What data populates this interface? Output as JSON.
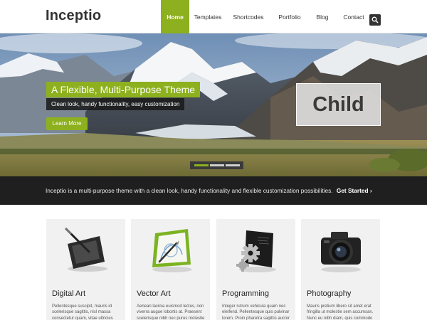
{
  "header": {
    "logo": "Inceptio",
    "nav": [
      "Home",
      "Templates",
      "Shortcodes",
      "Portfolio",
      "Blog",
      "Contact"
    ],
    "search_icon": "search-icon"
  },
  "hero": {
    "title": "A Flexible, Multi-Purpose Theme",
    "subtitle": "Clean look, handy functionality, easy customization",
    "button": "Learn More",
    "badge": "Child",
    "slides_total": 3,
    "active_slide": 1
  },
  "tagline": {
    "text": "Inceptio is a multi-purpose theme with a clean look, handy functionality and flexible customization possibilities.",
    "cta": "Get Started ›"
  },
  "features": [
    {
      "title": "Digital Art",
      "icon": "drawing-tablet-icon",
      "text": "Pellentesque suscipit, mauris id scelerisque sagittis, nisl massa consectetur quam, vitae ultricies justo leo eu elit vestibulum."
    },
    {
      "title": "Vector Art",
      "icon": "vector-pen-icon",
      "text": "Aenean lacinia euismod lectus, non viverra augue lobortis at. Praesent scelerisque nibh nec purus molestie sed hendrerit."
    },
    {
      "title": "Programming",
      "icon": "gears-icon",
      "text": "Integer rutrum vehicula quam nec eleifend. Pellentesque quis pulvinar lorem. Proin pharetra sagittis auctor mauris tristique."
    },
    {
      "title": "Photography",
      "icon": "camera-icon",
      "text": "Mauris pretium libero sit amet erat fringilla ut molestie sem accumsan. Nunc eu nibh diam, quis commodo diam curabitur."
    }
  ],
  "colors": {
    "accent": "#8db01e",
    "dark": "#1f1f1f"
  }
}
